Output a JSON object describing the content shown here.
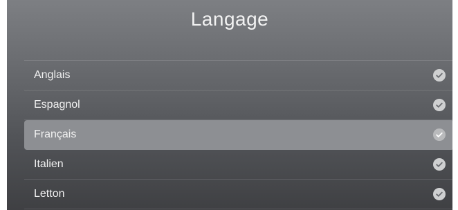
{
  "screen": {
    "title": "Langage"
  },
  "languages": [
    {
      "label": "Anglais",
      "selected": false
    },
    {
      "label": "Espagnol",
      "selected": false
    },
    {
      "label": "Français",
      "selected": true
    },
    {
      "label": "Italien",
      "selected": false
    },
    {
      "label": "Letton",
      "selected": false
    }
  ],
  "colors": {
    "background_top": "#7d7f83",
    "background_bottom": "#3f4043",
    "selected_row": "#8d8f93",
    "check_bg": "#cfd0d1",
    "check_mark": "#6a6c70"
  },
  "icons": {
    "row_indicator": "check-circle-icon"
  }
}
